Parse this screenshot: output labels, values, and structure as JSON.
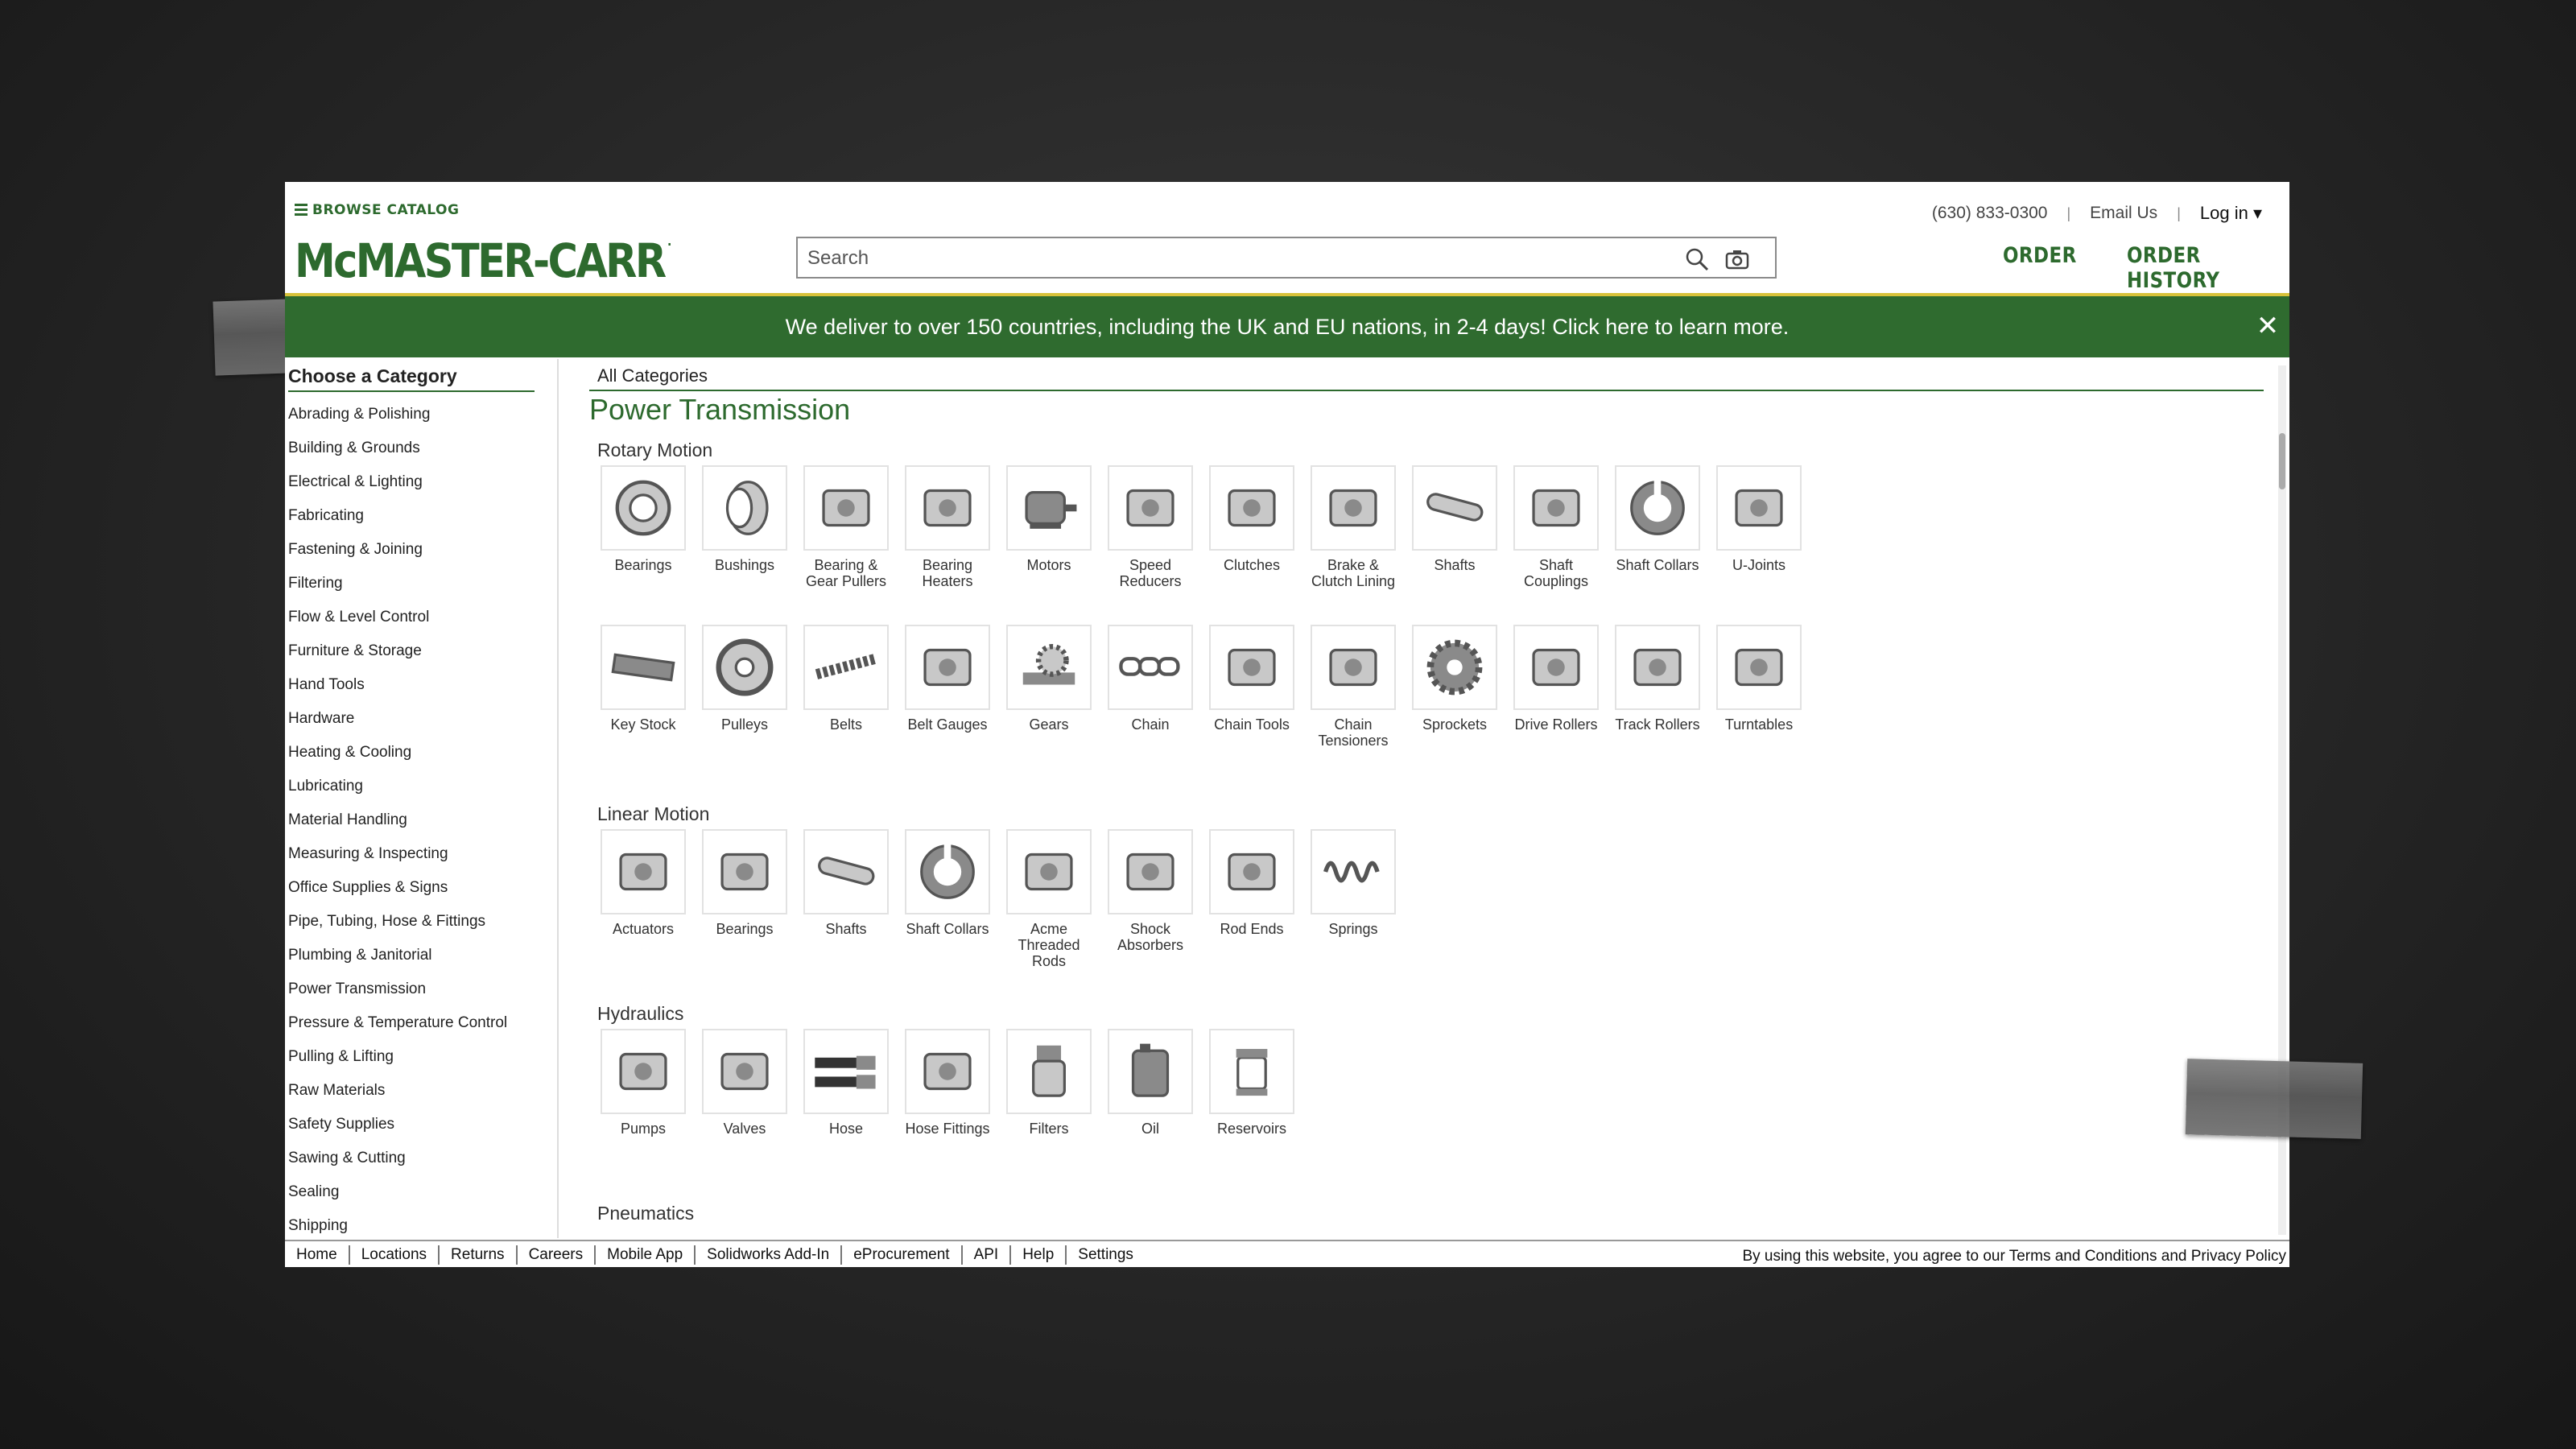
{
  "header": {
    "browse_label": "BROWSE CATALOG",
    "logo_text": "McMASTER-CARR",
    "logo_mark": ".",
    "search_placeholder": "Search",
    "phone": "(630) 833-0300",
    "email": "Email Us",
    "login": "Log in",
    "order": "ORDER",
    "order_history": "ORDER HISTORY",
    "brand_color": "#2d6a2e"
  },
  "banner": {
    "text": "We deliver to over 150 countries, including the UK and EU nations, in 2-4 days! Click here to learn more.",
    "close": "✕"
  },
  "sidebar": {
    "title": "Choose a Category",
    "items": [
      "Abrading & Polishing",
      "Building & Grounds",
      "Electrical & Lighting",
      "Fabricating",
      "Fastening & Joining",
      "Filtering",
      "Flow & Level Control",
      "Furniture & Storage",
      "Hand Tools",
      "Hardware",
      "Heating & Cooling",
      "Lubricating",
      "Material Handling",
      "Measuring & Inspecting",
      "Office Supplies & Signs",
      "Pipe, Tubing, Hose & Fittings",
      "Plumbing & Janitorial",
      "Power Transmission",
      "Pressure & Temperature Control",
      "Pulling & Lifting",
      "Raw Materials",
      "Safety Supplies",
      "Sawing & Cutting",
      "Sealing",
      "Shipping"
    ]
  },
  "main": {
    "all_categories": "All Categories",
    "title": "Power Transmission",
    "sections": [
      {
        "name": "Rotary Motion",
        "rows": [
          [
            [
              "Bearings",
              "bearing-icon"
            ],
            [
              "Bushings",
              "bushing-icon"
            ],
            [
              "Bearing & Gear Pullers",
              "puller-icon"
            ],
            [
              "Bearing Heaters",
              "heater-icon"
            ],
            [
              "Motors",
              "motor-icon"
            ],
            [
              "Speed Reducers",
              "reducer-icon"
            ],
            [
              "Clutches",
              "clutch-icon"
            ],
            [
              "Brake & Clutch Lining",
              "lining-icon"
            ],
            [
              "Shafts",
              "shaft-icon"
            ],
            [
              "Shaft Couplings",
              "coupling-icon"
            ],
            [
              "Shaft Collars",
              "collar-icon"
            ],
            [
              "U-Joints",
              "ujoint-icon"
            ]
          ],
          [
            [
              "Key Stock",
              "keystock-icon"
            ],
            [
              "Pulleys",
              "pulley-icon"
            ],
            [
              "Belts",
              "belt-icon"
            ],
            [
              "Belt Gauges",
              "belt-gauge-icon"
            ],
            [
              "Gears",
              "gear-icon"
            ],
            [
              "Chain",
              "chain-icon"
            ],
            [
              "Chain Tools",
              "chain-tool-icon"
            ],
            [
              "Chain Tensioners",
              "tensioner-icon"
            ],
            [
              "Sprockets",
              "sprocket-icon"
            ],
            [
              "Drive Rollers",
              "drive-roller-icon"
            ],
            [
              "Track Rollers",
              "track-roller-icon"
            ],
            [
              "Turntables",
              "turntable-icon"
            ]
          ]
        ]
      },
      {
        "name": "Linear Motion",
        "rows": [
          [
            [
              "Actuators",
              "actuator-icon"
            ],
            [
              "Bearings",
              "linear-bearing-icon"
            ],
            [
              "Shafts",
              "linear-shaft-icon"
            ],
            [
              "Shaft Collars",
              "collar-icon"
            ],
            [
              "Acme Threaded Rods",
              "threaded-rod-icon"
            ],
            [
              "Shock Absorbers",
              "shock-absorber-icon"
            ],
            [
              "Rod Ends",
              "rod-end-icon"
            ],
            [
              "Springs",
              "spring-icon"
            ]
          ]
        ]
      },
      {
        "name": "Hydraulics",
        "rows": [
          [
            [
              "Pumps",
              "pump-icon"
            ],
            [
              "Valves",
              "valve-icon"
            ],
            [
              "Hose",
              "hose-icon"
            ],
            [
              "Hose Fittings",
              "hose-fitting-icon"
            ],
            [
              "Filters",
              "filter-icon"
            ],
            [
              "Oil",
              "oil-icon"
            ],
            [
              "Reservoirs",
              "reservoir-icon"
            ]
          ]
        ]
      },
      {
        "name": "Pneumatics",
        "rows": []
      }
    ]
  },
  "footer": {
    "links": [
      "Home",
      "Locations",
      "Returns",
      "Careers",
      "Mobile App",
      "Solidworks Add-In",
      "eProcurement",
      "API",
      "Help",
      "Settings"
    ],
    "legal": "By using this website, you agree to our Terms and Conditions and Privacy Policy"
  }
}
